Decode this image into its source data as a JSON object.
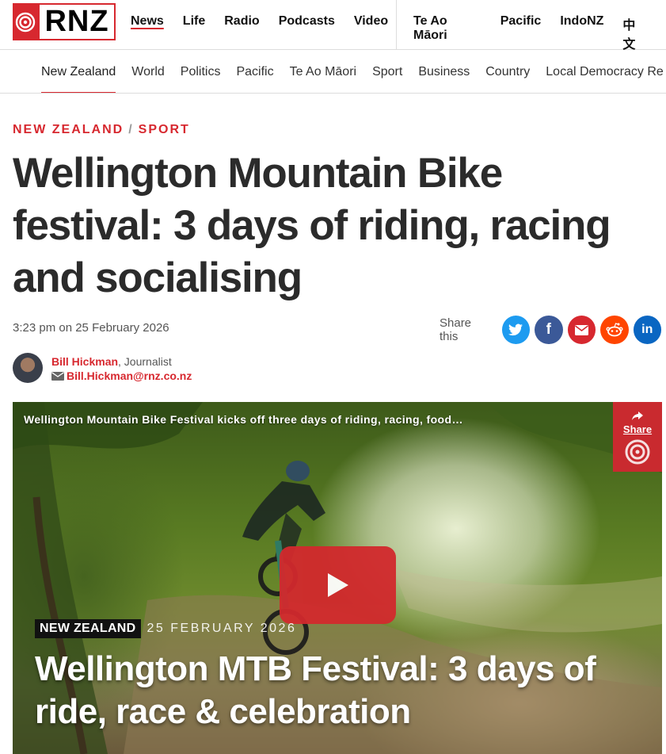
{
  "logo": {
    "text": "RNZ"
  },
  "main_nav": [
    {
      "label": "News",
      "active": true
    },
    {
      "label": "Life"
    },
    {
      "label": "Radio"
    },
    {
      "label": "Podcasts"
    },
    {
      "label": "Video"
    }
  ],
  "secondary_nav": [
    {
      "label": "Te Ao Māori"
    },
    {
      "label": "Pacific"
    },
    {
      "label": "IndoNZ"
    },
    {
      "label": "中文"
    }
  ],
  "sub_nav": [
    {
      "label": "New Zealand",
      "active": true
    },
    {
      "label": "World"
    },
    {
      "label": "Politics"
    },
    {
      "label": "Pacific"
    },
    {
      "label": "Te Ao Māori"
    },
    {
      "label": "Sport"
    },
    {
      "label": "Business"
    },
    {
      "label": "Country"
    },
    {
      "label": "Local Democracy Re"
    }
  ],
  "breadcrumb": {
    "section": "NEW ZEALAND",
    "separator": "/",
    "subsection": "SPORT"
  },
  "article": {
    "title": "Wellington Mountain Bike festival: 3 days of riding, racing and socialising",
    "timestamp": "3:23 pm on 25 February 2026",
    "share_label": "Share this",
    "share_buttons": [
      {
        "name": "twitter",
        "icon": "twitter-icon",
        "color": "#1d9bf0",
        "glyph": "🐦"
      },
      {
        "name": "facebook",
        "icon": "facebook-icon",
        "color": "#3b5998",
        "glyph": "f"
      },
      {
        "name": "email",
        "icon": "mail-icon",
        "color": "#d7282f",
        "glyph": "✉"
      },
      {
        "name": "reddit",
        "icon": "reddit-icon",
        "color": "#ff4500",
        "glyph": "👽"
      },
      {
        "name": "linkedin",
        "icon": "linkedin-icon",
        "color": "#0a66c2",
        "glyph": "in"
      }
    ],
    "author": {
      "name": "Bill Hickman",
      "role": ", Journalist",
      "email": "Bill.Hickman@rnz.co.nz"
    }
  },
  "video": {
    "title": "Wellington Mountain Bike Festival kicks off three days of riding, racing, food…",
    "share_label": "Share",
    "tag": "NEW ZEALAND",
    "date": "25 FEBRUARY 2026",
    "headline": "Wellington MTB Festival: 3 days of ride, race & celebration"
  }
}
